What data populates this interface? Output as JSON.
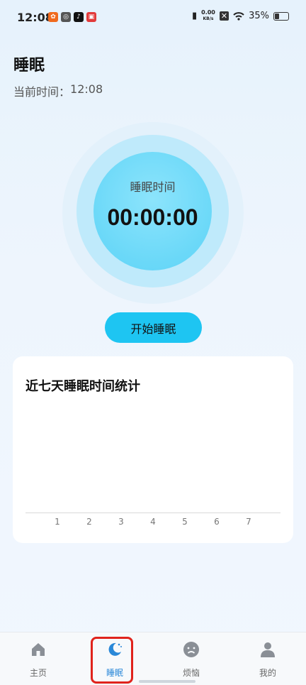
{
  "status_bar": {
    "time": "12:08",
    "net_speed_value": "0.00",
    "net_speed_unit": "KB/s",
    "battery": "35%"
  },
  "header": {
    "title": "睡眠",
    "current_time_label": "当前时间：",
    "current_time_value": "12:08"
  },
  "timer": {
    "label": "睡眠时间",
    "value": "00:00:00"
  },
  "start_button": {
    "label": "开始睡眠"
  },
  "stats": {
    "title": "近七天睡眠时间统计",
    "x_ticks": [
      "1",
      "2",
      "3",
      "4",
      "5",
      "6",
      "7"
    ]
  },
  "tabbar": {
    "items": [
      {
        "label": "主页",
        "icon": "home-icon"
      },
      {
        "label": "睡眠",
        "icon": "moon-icon",
        "active": true
      },
      {
        "label": "烦恼",
        "icon": "sad-face-icon"
      },
      {
        "label": "我的",
        "icon": "user-icon"
      }
    ]
  },
  "colors": {
    "accent": "#1ec5f2",
    "active_tab": "#2a88d8",
    "highlight": "#e0231c"
  }
}
